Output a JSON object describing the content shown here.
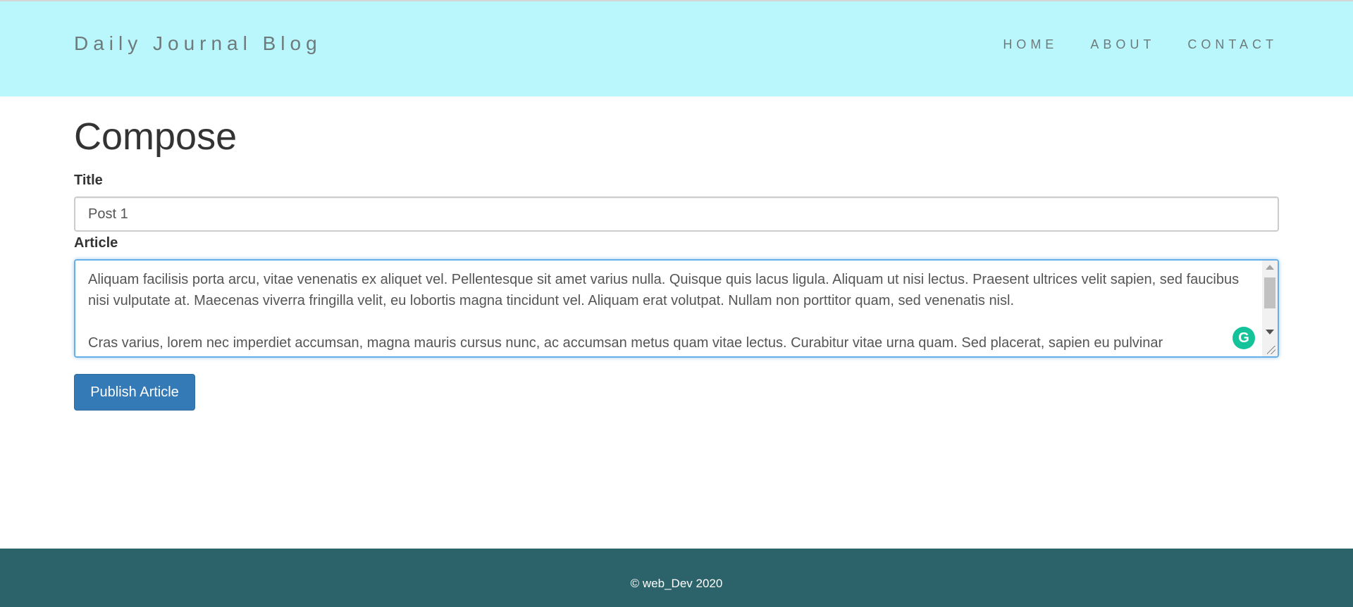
{
  "header": {
    "brand": "Daily Journal Blog",
    "nav": [
      {
        "label": "HOME"
      },
      {
        "label": "ABOUT"
      },
      {
        "label": "CONTACT"
      }
    ]
  },
  "compose": {
    "heading": "Compose",
    "title_label": "Title",
    "title_value": "Post 1",
    "article_label": "Article",
    "article_value": "Aliquam facilisis porta arcu, vitae venenatis ex aliquet vel. Pellentesque sit amet varius nulla. Quisque quis lacus ligula. Aliquam ut nisi lectus. Praesent ultrices velit sapien, sed faucibus nisi vulputate at. Maecenas viverra fringilla velit, eu lobortis magna tincidunt vel. Aliquam erat volutpat. Nullam non porttitor quam, sed venenatis nisl.\n\nCras varius, lorem nec imperdiet accumsan, magna mauris cursus nunc, ac accumsan metus quam vitae lectus. Curabitur vitae urna quam. Sed placerat, sapien eu pulvinar",
    "publish_label": "Publish Article"
  },
  "footer": {
    "text": "© web_Dev 2020"
  },
  "colors": {
    "header_bg": "#baf7fd",
    "footer_bg": "#2c636a",
    "button_bg": "#337ab7",
    "focus_border": "#66afe9"
  },
  "icons": {
    "grammarly": "grammarly-icon"
  }
}
